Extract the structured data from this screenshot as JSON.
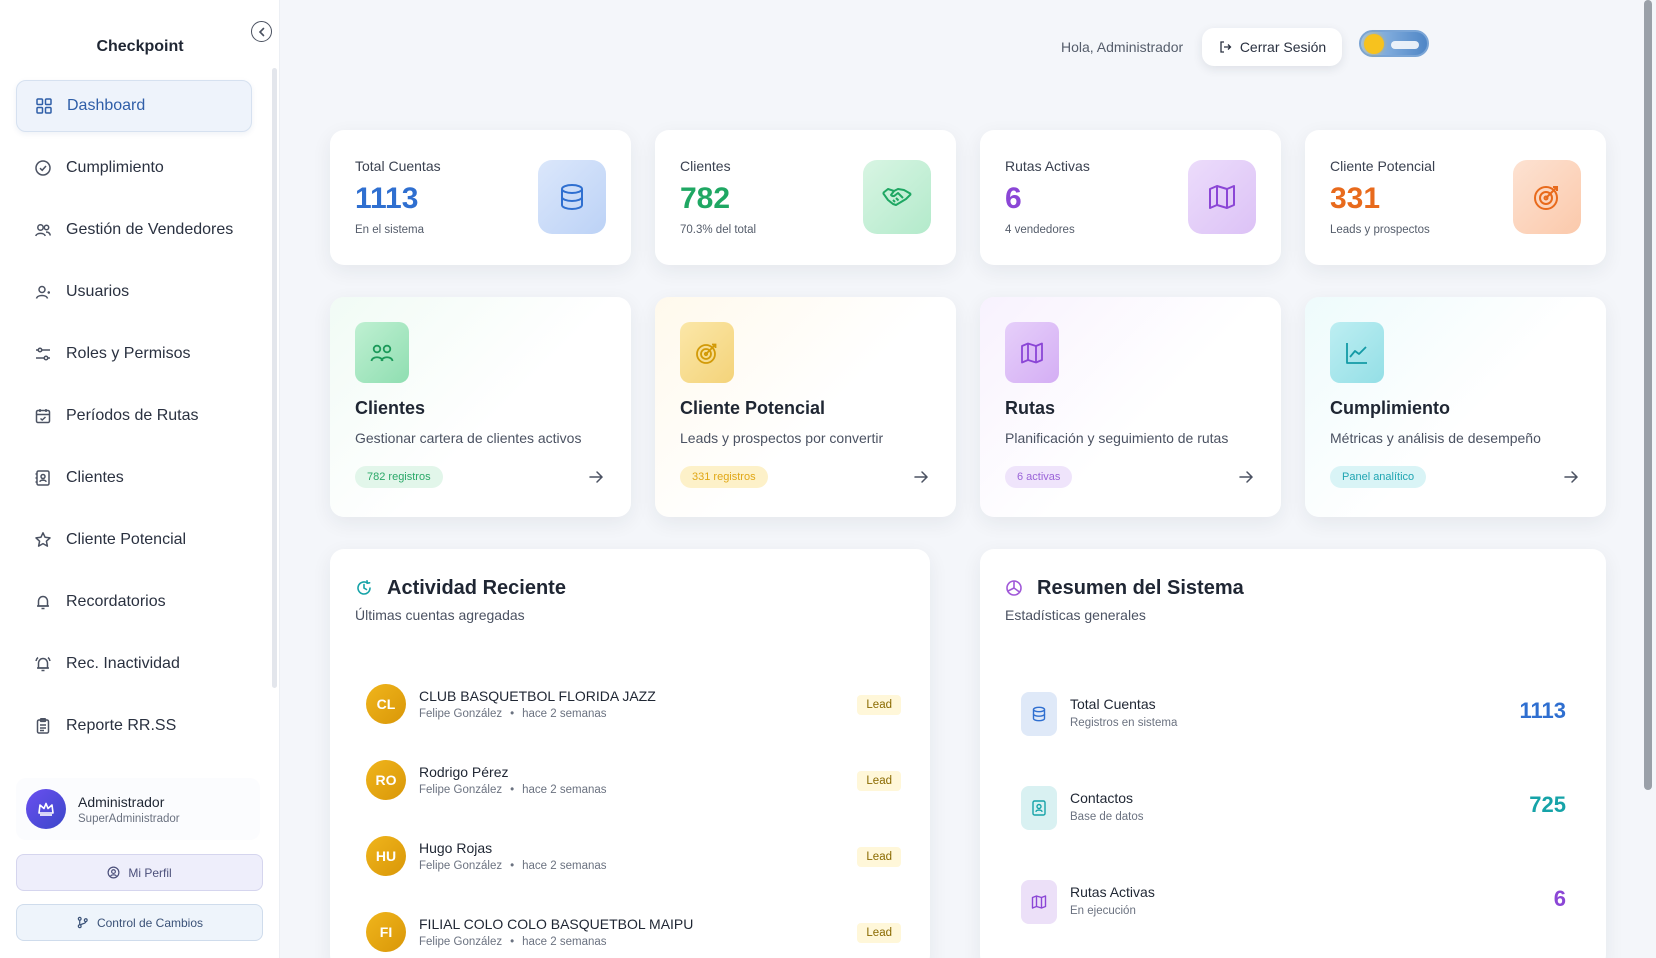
{
  "sidebar": {
    "brand": "Checkpoint",
    "items": [
      {
        "label": "Dashboard",
        "icon": "grid-icon"
      },
      {
        "label": "Cumplimiento",
        "icon": "check-circle-icon"
      },
      {
        "label": "Gestión de Vendedores",
        "icon": "users-icon"
      },
      {
        "label": "Usuarios",
        "icon": "user-icon"
      },
      {
        "label": "Roles y Permisos",
        "icon": "sliders-icon"
      },
      {
        "label": "Períodos de Rutas",
        "icon": "calendar-icon"
      },
      {
        "label": "Clientes",
        "icon": "contact-book-icon"
      },
      {
        "label": "Cliente Potencial",
        "icon": "star-icon"
      },
      {
        "label": "Recordatorios",
        "icon": "bell-icon"
      },
      {
        "label": "Rec. Inactividad",
        "icon": "bell-ring-icon"
      },
      {
        "label": "Reporte RR.SS",
        "icon": "clipboard-icon"
      }
    ],
    "user": {
      "name": "Administrador",
      "role": "SuperAdministrador"
    },
    "profile_button": "Mi Perfil",
    "changes_button": "Control de Cambios"
  },
  "header": {
    "greeting": "Hola, Administrador",
    "logout_label": "Cerrar Sesión"
  },
  "stats": [
    {
      "label": "Total Cuentas",
      "value": "1113",
      "sub": "En el sistema",
      "color": "#2f6fd0",
      "icon": "database-icon"
    },
    {
      "label": "Clientes",
      "value": "782",
      "sub": "70.3% del total",
      "color": "#1fa763",
      "icon": "handshake-icon"
    },
    {
      "label": "Rutas Activas",
      "value": "6",
      "sub": "4 vendedores",
      "color": "#8b46d6",
      "icon": "map-icon"
    },
    {
      "label": "Cliente Potencial",
      "value": "331",
      "sub": "Leads y prospectos",
      "color": "#e86a1c",
      "icon": "target-icon"
    }
  ],
  "modules": [
    {
      "title": "Clientes",
      "desc": "Gestionar cartera de clientes activos",
      "badge": "782 registros"
    },
    {
      "title": "Cliente Potencial",
      "desc": "Leads y prospectos por convertir",
      "badge": "331 registros"
    },
    {
      "title": "Rutas",
      "desc": "Planificación y seguimiento de rutas",
      "badge": "6 activas"
    },
    {
      "title": "Cumplimiento",
      "desc": "Métricas y análisis de desempeño",
      "badge": "Panel analítico"
    }
  ],
  "activity": {
    "title": "Actividad Reciente",
    "subtitle": "Últimas cuentas agregadas",
    "rows": [
      {
        "initials": "CL",
        "name": "CLUB BASQUETBOL FLORIDA JAZZ",
        "by": "Felipe González",
        "when": "hace 2 semanas",
        "badge": "Lead"
      },
      {
        "initials": "RO",
        "name": "Rodrigo Pérez",
        "by": "Felipe González",
        "when": "hace 2 semanas",
        "badge": "Lead"
      },
      {
        "initials": "HU",
        "name": "Hugo Rojas",
        "by": "Felipe González",
        "when": "hace 2 semanas",
        "badge": "Lead"
      },
      {
        "initials": "FI",
        "name": "FILIAL COLO COLO BASQUETBOL MAIPU",
        "by": "Felipe González",
        "when": "hace 2 semanas",
        "badge": "Lead"
      }
    ]
  },
  "summary": {
    "title": "Resumen del Sistema",
    "subtitle": "Estadísticas generales",
    "rows": [
      {
        "label": "Total Cuentas",
        "sub": "Registros en sistema",
        "value": "1113",
        "color": "#2f6fd0",
        "icon": "database-icon"
      },
      {
        "label": "Contactos",
        "sub": "Base de datos",
        "value": "725",
        "color": "#16a3a8",
        "icon": "contact-book-icon"
      },
      {
        "label": "Rutas Activas",
        "sub": "En ejecución",
        "value": "6",
        "color": "#8b46d6",
        "icon": "map-icon"
      }
    ]
  }
}
